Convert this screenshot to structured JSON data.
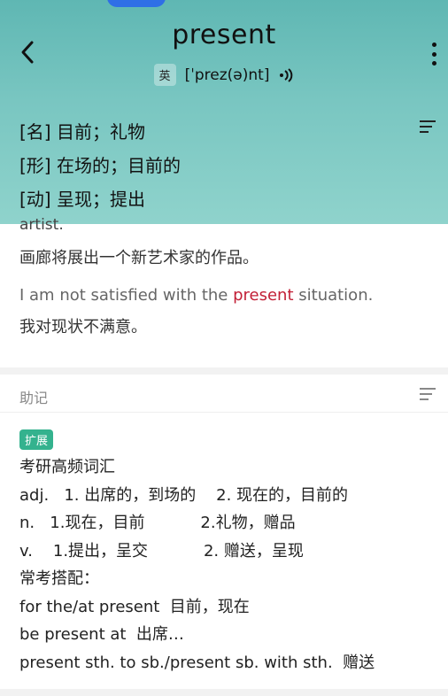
{
  "header": {
    "word": "present",
    "accent_tag": "英",
    "phonetic": "[ˈprez(ə)nt]",
    "back_icon": "chevron-left-icon",
    "more_icon": "more-vertical-icon",
    "speaker_icon": "speaker-icon"
  },
  "definitions": [
    "[名] 目前；礼物",
    "[形] 在场的；目前的",
    "[动] 呈现；提出"
  ],
  "examples": {
    "partial_text": "artist.",
    "zh1": "画廊将展出一个新艺术家的作品。",
    "en2_before": "I am not satisfied with the ",
    "en2_highlight": "present",
    "en2_after": " situation.",
    "zh2": "我对现状不满意。"
  },
  "mnemonic": {
    "title": "助记",
    "badge": "扩展",
    "lines": [
      "考研高频词汇",
      "adj.   1. 出席的，到场的    2. 现在的，目前的",
      "n.   1.现在，目前           2.礼物，赠品",
      "v.    1.提出，呈交           2. 赠送，呈现",
      "常考搭配：",
      "for the/at present  目前，现在",
      "be present at  出席…",
      "present sth. to sb./present sb. with sth.  赠送"
    ]
  },
  "colors": {
    "header_gradient_top": "#5fb7b3",
    "header_gradient_bottom": "#8fd3cc",
    "highlight": "#c21f36",
    "badge": "#34b28e",
    "top_pill": "#2f6fe6"
  }
}
